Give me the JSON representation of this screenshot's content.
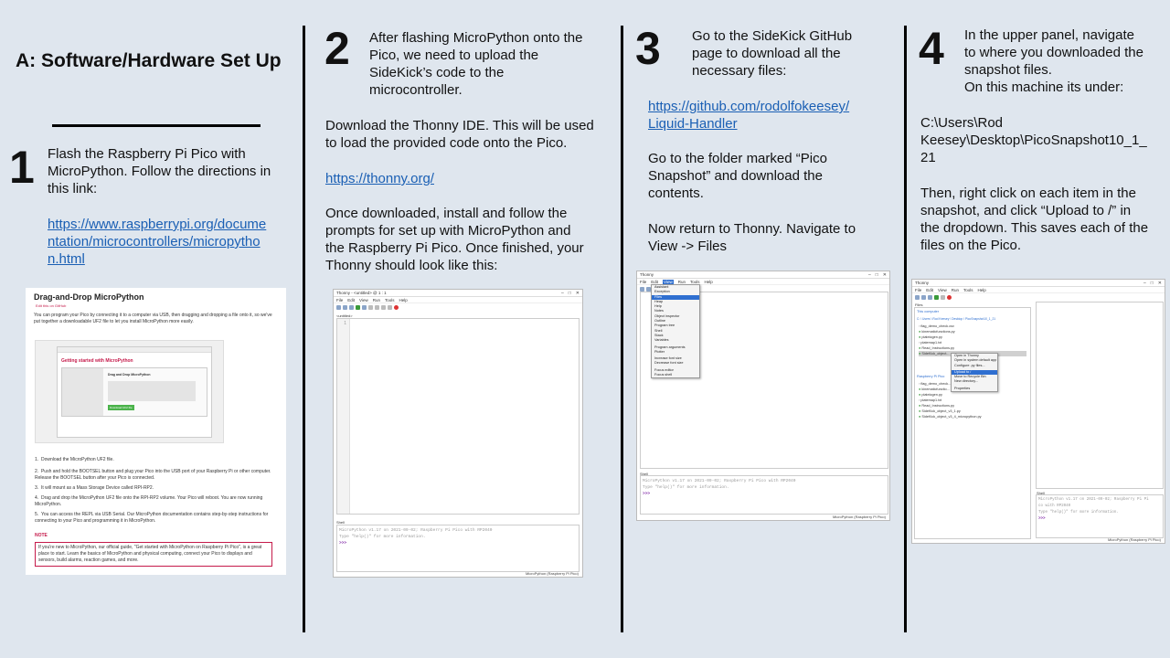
{
  "section_a": {
    "title": "A: Software/Hardware Set Up"
  },
  "step1": {
    "number": "1",
    "text": "Flash the Raspberry Pi Pico with\nMicroPython.  Follow the directions in\nthis link:",
    "link": "https://www.raspberrypi.org/docume\nntation/microcontrollers/micropytho\nn.html",
    "screenshot": {
      "heading": "Drag-and-Drop MicroPython",
      "edit_link": "Edit this on GitHub",
      "intro": "You can program your Pico by connecting it to a computer via USB, then dragging and dropping a file onto it, so we've put together a downloadable UF2 file to let you install MicroPython more easily.",
      "callout_number": "1",
      "card_title": "Getting started with MicroPython",
      "card_subtitle": "Drag and Drop MicroPython",
      "download_button": "Download UF2 file",
      "list": [
        "Download the MicroPython UF2 file.",
        "Push and hold the BOOTSEL button and plug your Pico into the USB port of your Raspberry Pi or other computer. Release the BOOTSEL button after your Pico is connected.",
        "It will mount as a Mass Storage Device called RPI-RP2.",
        "Drag and drop the MicroPython UF2 file onto the RPI-RP2 volume. Your Pico will reboot. You are now running MicroPython.",
        "You can access the REPL via USB Serial. Our MicroPython documentation contains step-by-step instructions for connecting to your Pico and programming it in MicroPython."
      ],
      "note_label": "NOTE",
      "note_text": "If you're new to MicroPython, our official guide, \"Get started with MicroPython on Raspberry Pi Pico\", is a great place to start. Learn the basics of MicroPython and physical computing, connect your Pico to displays and sensors, build alarms, reaction games, and more."
    }
  },
  "step2": {
    "number": "2",
    "intro": "After flashing MicroPython onto the\nPico, we need to upload the\nSideKick’s code to the\nmicrocontroller.",
    "text1": "Download the Thonny IDE. This will be used\nto load the provided code onto the Pico.",
    "link": "https://thonny.org/",
    "text2": "Once downloaded,  install and follow the\nprompts for set up with MicroPython and\nthe Raspberry Pi Pico. Once finished, your\nThonny should look like this:",
    "screenshot": {
      "window_title": "Thonny - <untitled> @ 1 : 1",
      "menus": [
        "File",
        "Edit",
        "View",
        "Run",
        "Tools",
        "Help"
      ],
      "tab": "<untitled>",
      "line_number": "1",
      "shell_label": "Shell",
      "shell_line1": "MicroPython v1.17 on 2021-09-02; Raspberry Pi Pico with RP2040",
      "shell_line2": "Type \"help()\" for more information.",
      "prompt": ">>>",
      "status": "MicroPython (Raspberry Pi Pico)"
    }
  },
  "step3": {
    "number": "3",
    "intro": "Go to the SideKick GitHub\npage to download  all the\nnecessary files:",
    "link": "https://github.com/rodolfokeesey/\nLiquid-Handler",
    "text1": "Go to the folder marked “Pico\nSnapshot” and download the\ncontents.",
    "text2": "Now return to Thonny. Navigate to\nView -> Files",
    "screenshot": {
      "window_title": "Thonny",
      "menus": [
        "File",
        "Edit",
        "View",
        "Run",
        "Tools",
        "Help"
      ],
      "view_menu": [
        "Assistant",
        "Exception",
        "Files",
        "Heap",
        "Help",
        "Notes",
        "Object inspector",
        "Outline",
        "Program tree",
        "Shell",
        "Stack",
        "Variables",
        "",
        "Program arguments",
        "Plotter",
        "",
        "Increase font size",
        "Decrease font size",
        "",
        "Focus editor",
        "Focus shell"
      ],
      "selected_item": "Files",
      "shell_label": "Shell",
      "shell_line1": "MicroPython v1.17 on 2021-09-02; Raspberry Pi Pico with RP2040",
      "shell_line2": "Type \"help()\" for more information.",
      "prompt": ">>>",
      "status": "MicroPython (Raspberry Pi Pico)"
    }
  },
  "step4": {
    "number": "4",
    "intro": "In the upper panel, navigate\nto where you downloaded the\nsnapshot files.\nOn this machine its under:",
    "path": "C:\\Users\\Rod\nKeesey\\Desktop\\PicoSnapshot10_1_\n21",
    "text": "Then, right click on each item in the\nsnapshot, and click “Upload to /” in\nthe dropdown.  This saves each of the\nfiles on the Pico.",
    "screenshot": {
      "window_title": "Thonny",
      "menus": [
        "File",
        "Edit",
        "View",
        "Run",
        "Tools",
        "Help"
      ],
      "files_tab": "Files",
      "this_computer": "This computer",
      "computer_path": "C: \\ Users \\ Rod Keesey \\ Desktop \\ PicoSnapshot10_1_21",
      "computer_files": [
        "flag_demo_check.csv",
        "kinematicfunctions.py",
        "platelogen.py",
        "platemap1.txt",
        "Read_Instructions.py",
        "SideKick_object..."
      ],
      "context_menu": [
        "Open in Thonny",
        "Open in system default app",
        "Configure .py files...",
        "",
        "Upload to /",
        "Move to Recycle Bin",
        "New directory...",
        "",
        "Properties"
      ],
      "pico_label": "Raspberry Pi Pico",
      "pico_files": [
        "flag_demo_check...",
        "kinematicfunctio...",
        "platelogen.py",
        "platemap1.txt",
        "Read_Instructions.py",
        "SideKick_object_v3_1.py",
        "SideKick_object_v3_4_micropython.py"
      ],
      "shell_label": "Shell",
      "shell_line1": "MicroPython v1.17 on 2021-09-02; Raspberry Pi Pi",
      "shell_line1b": "co with RP2040",
      "shell_line2": "Type \"help()\" for more information.",
      "prompt": ">>>",
      "status": "MicroPython (Raspberry Pi Pico)"
    }
  }
}
